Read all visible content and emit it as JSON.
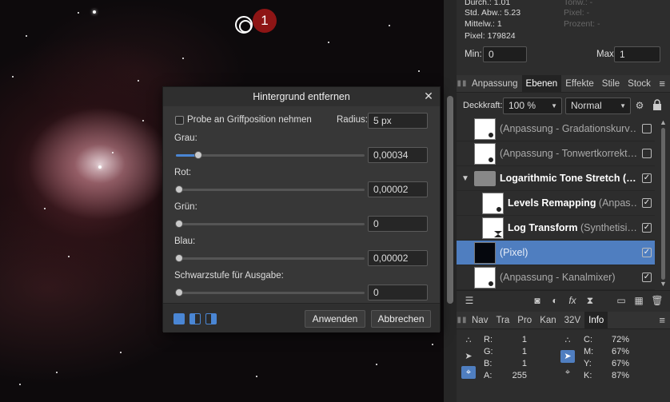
{
  "histogram": {
    "durch_label": "Durch.: 1.01",
    "std_label": "Std. Abw.: 5.23",
    "mittel_label": "Mittelw.: 1",
    "pixel_label": "Pixel: 179824",
    "tonw_label": "Tonw.: -",
    "pixel_right_label": "Pixel: -",
    "prozent_label": "Prozent: -",
    "min_label": "Min:",
    "min_value": "0",
    "max_label": "Max:",
    "max_value": "1"
  },
  "panel_tabs": [
    "Anpassung",
    "Ebenen",
    "Effekte",
    "Stile",
    "Stock"
  ],
  "opacity": {
    "label": "Deckkraft:",
    "value": "100 %",
    "blend_mode": "Normal"
  },
  "layers": [
    {
      "name": "(Anpassung - Gradationskurv…",
      "style": "dim",
      "checked": false
    },
    {
      "name": "(Anpassung - Tonwertkorrekt…",
      "style": "dim",
      "checked": false
    },
    {
      "name": "Logarithmic Tone Stretch (…",
      "style": "bold",
      "checked": true
    },
    {
      "name_bold": "Levels Remapping",
      "name_dim": " (Anpas…",
      "checked": true
    },
    {
      "name_bold": "Log Transform",
      "name_dim": " (Synthetisi…",
      "checked": true
    },
    {
      "name": "(Pixel)",
      "style": "sel",
      "checked": true
    },
    {
      "name": "(Anpassung - Kanalmixer)",
      "style": "dim",
      "checked": true
    }
  ],
  "info_tabs": [
    "Nav",
    "Tra",
    "Pro",
    "Kan",
    "32V",
    "Info"
  ],
  "info": {
    "r_label": "R:",
    "r_value": "1",
    "g_label": "G:",
    "g_value": "1",
    "b_label": "B:",
    "b_value": "1",
    "a_label": "A:",
    "a_value": "255",
    "c_label": "C:",
    "c_value": "72%",
    "m_label": "M:",
    "m_value": "67%",
    "y_label": "Y:",
    "y_value": "67%",
    "k_label": "K:",
    "k_value": "87%"
  },
  "marker": {
    "number": "1"
  },
  "dialog": {
    "title": "Hintergrund entfernen",
    "probe_label": "Probe an Griffposition nehmen",
    "radius_label": "Radius:",
    "radius_value": "5 px",
    "grau_label": "Grau:",
    "grau_value": "0,00034",
    "grau_level": 0.12,
    "rot_label": "Rot:",
    "rot_value": "0,00002",
    "gruen_label": "Grün:",
    "gruen_value": "0",
    "blau_label": "Blau:",
    "blau_value": "0,00002",
    "schwarz_label": "Schwarzstufe für Ausgabe:",
    "schwarz_value": "0",
    "apply_label": "Anwenden",
    "cancel_label": "Abbrechen"
  },
  "colors": {
    "accent": "#4a86d4",
    "selection": "#4f7ec0",
    "marker": "#8e1515"
  }
}
